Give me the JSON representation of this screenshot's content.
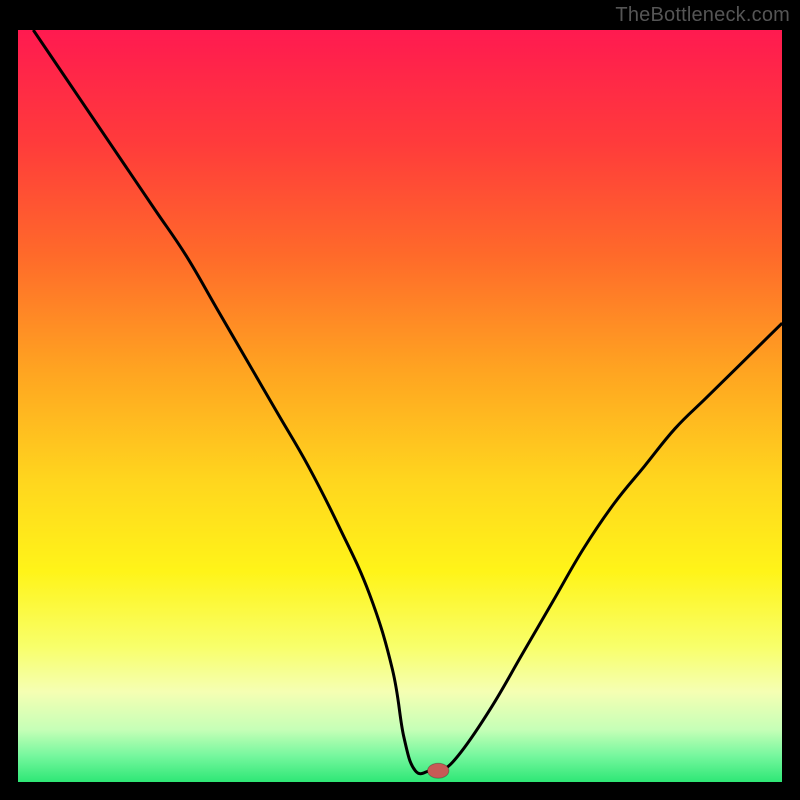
{
  "watermark": "TheBottleneck.com",
  "chart_data": {
    "type": "line",
    "title": "",
    "xlabel": "",
    "ylabel": "",
    "xlim": [
      0,
      100
    ],
    "ylim": [
      0,
      100
    ],
    "grid": false,
    "legend": false,
    "series": [
      {
        "name": "curve",
        "x": [
          2,
          6,
          10,
          14,
          18,
          22,
          26,
          30,
          34,
          38,
          42,
          46,
          49,
          50.5,
          52,
          54,
          55.5,
          58,
          62,
          66,
          70,
          74,
          78,
          82,
          86,
          90,
          94,
          98,
          100
        ],
        "y": [
          100,
          94,
          88,
          82,
          76,
          70,
          63,
          56,
          49,
          42,
          34,
          25,
          15,
          6,
          1.5,
          1.5,
          1.5,
          4,
          10,
          17,
          24,
          31,
          37,
          42,
          47,
          51,
          55,
          59,
          61
        ]
      }
    ],
    "marker": {
      "x": 55,
      "y": 1.5,
      "color": "#c85a56"
    },
    "background_gradient": {
      "stops": [
        {
          "offset": 0.0,
          "color": "#ff1a50"
        },
        {
          "offset": 0.15,
          "color": "#ff3b3b"
        },
        {
          "offset": 0.3,
          "color": "#ff6a2a"
        },
        {
          "offset": 0.45,
          "color": "#ffa321"
        },
        {
          "offset": 0.6,
          "color": "#ffd61e"
        },
        {
          "offset": 0.72,
          "color": "#fff419"
        },
        {
          "offset": 0.82,
          "color": "#f8ff6a"
        },
        {
          "offset": 0.88,
          "color": "#f5ffb3"
        },
        {
          "offset": 0.93,
          "color": "#c6ffb7"
        },
        {
          "offset": 0.965,
          "color": "#76f79e"
        },
        {
          "offset": 1.0,
          "color": "#2ee776"
        }
      ]
    },
    "curve_stroke": "#000000",
    "curve_width": 3
  }
}
